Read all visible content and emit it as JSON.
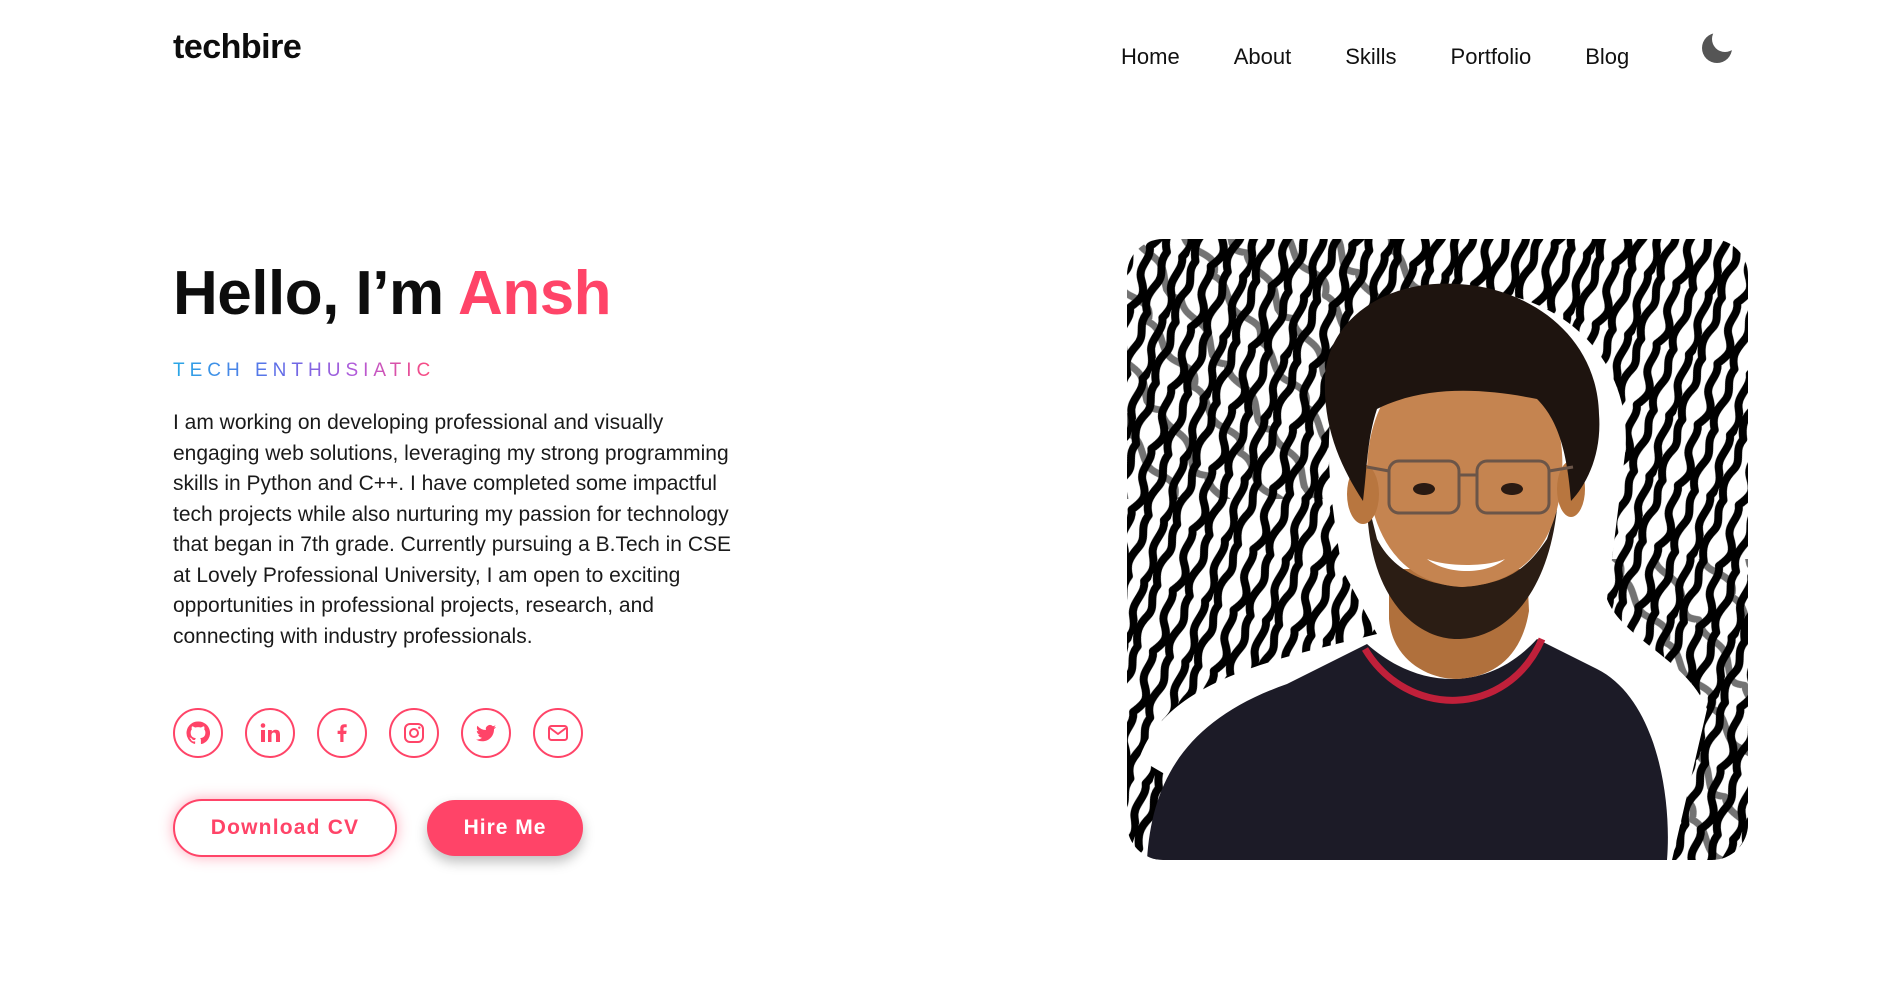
{
  "brand": {
    "logo": "techbire"
  },
  "nav": {
    "items": [
      "Home",
      "About",
      "Skills",
      "Portfolio",
      "Blog"
    ],
    "theme_toggle_icon": "moon-icon"
  },
  "hero": {
    "greeting": "Hello, I’m ",
    "name": "Ansh",
    "subtitle": "TECH ENTHUSIATIC",
    "bio": "I am working on developing professional and visually engaging web solutions, leveraging my strong programming skills in Python and C++. I have completed some impactful tech projects while also nurturing my passion for technology that began in 7th grade. Currently pursuing a B.Tech in CSE at Lovely Professional University, I am open to exciting opportunities in professional projects, research, and connecting with industry professionals."
  },
  "socials": [
    "github-icon",
    "linkedin-icon",
    "facebook-icon",
    "instagram-icon",
    "twitter-icon",
    "mail-icon"
  ],
  "buttons": {
    "download_cv": "Download CV",
    "hire_me": "Hire Me"
  },
  "colors": {
    "accent": "#ff4468",
    "text": "#111111",
    "background": "#ffffff"
  }
}
